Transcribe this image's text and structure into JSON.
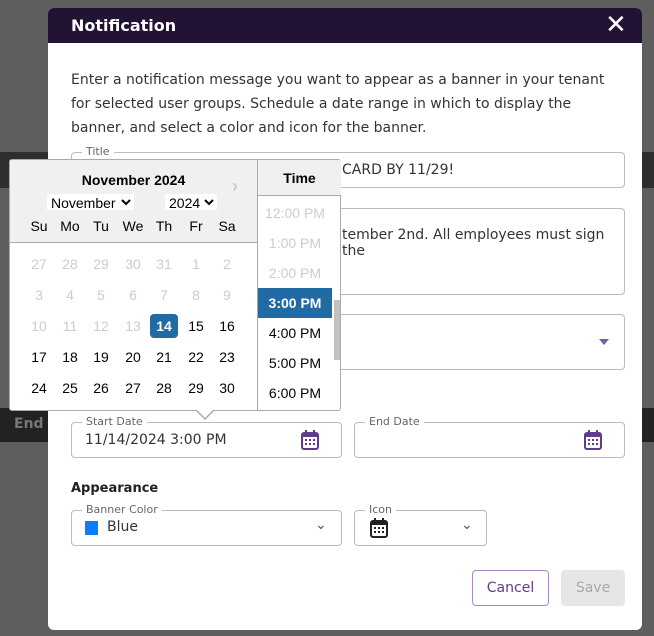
{
  "background": {
    "partial_label": "End"
  },
  "modal": {
    "title": "Notification",
    "close_icon": "close-x-icon",
    "intro": "Enter a notification message you want to appear as a banner in your tenant for selected user groups. Schedule a date range in which to display the banner, and select a color and icon for the banner.",
    "title_field": {
      "label": "Title",
      "value_visible": "CARD BY 11/29!"
    },
    "message_field": {
      "value_visible": "tember 2nd. All employees must sign the"
    },
    "start_date": {
      "label": "Start Date",
      "value": "11/14/2024 3:00 PM"
    },
    "end_date": {
      "label": "End Date",
      "value": ""
    },
    "appearance": {
      "heading": "Appearance",
      "banner_color_label": "Banner Color",
      "banner_color_value": "Blue",
      "banner_color_swatch": "#0a7cff",
      "icon_label": "Icon",
      "icon_value": "calendar-icon"
    },
    "buttons": {
      "cancel": "Cancel",
      "save": "Save"
    }
  },
  "datepicker": {
    "header": "November 2024",
    "month_select": "November",
    "year_select": "2024",
    "weekdays": [
      "Su",
      "Mo",
      "Tu",
      "We",
      "Th",
      "Fr",
      "Sa"
    ],
    "weeks": [
      [
        "27",
        "28",
        "29",
        "30",
        "31",
        "1",
        "2"
      ],
      [
        "3",
        "4",
        "5",
        "6",
        "7",
        "8",
        "9"
      ],
      [
        "10",
        "11",
        "12",
        "13",
        "14",
        "15",
        "16"
      ],
      [
        "17",
        "18",
        "19",
        "20",
        "21",
        "22",
        "23"
      ],
      [
        "24",
        "25",
        "26",
        "27",
        "28",
        "29",
        "30"
      ]
    ],
    "selected_day": "14",
    "time_header": "Time",
    "times": [
      "12:00 PM",
      "1:00 PM",
      "2:00 PM",
      "3:00 PM",
      "4:00 PM",
      "5:00 PM",
      "6:00 PM"
    ],
    "selected_time": "3:00 PM",
    "accent": "#216ba5"
  }
}
